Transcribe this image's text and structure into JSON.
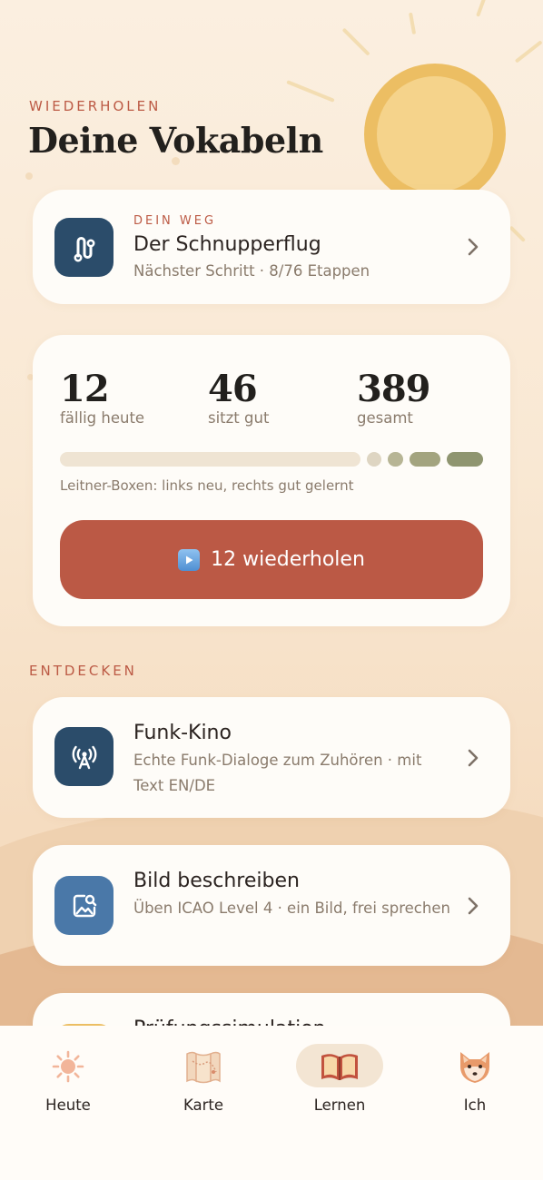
{
  "header": {
    "eyebrow": "WIEDERHOLEN",
    "title": "Deine Vokabeln"
  },
  "path_card": {
    "kicker": "DEIN WEG",
    "title": "Der Schnupperflug",
    "subtitle": "Nächster Schritt · 8/76 Etappen",
    "icon": "route-icon"
  },
  "stats": {
    "due": {
      "value": "12",
      "label": "fällig heute"
    },
    "good": {
      "value": "46",
      "label": "sitzt gut"
    },
    "total": {
      "value": "389",
      "label": "gesamt"
    },
    "leitner_caption": "Leitner-Boxen: links neu, rechts gut gelernt",
    "leitner_boxes": [
      0.77,
      0.01,
      0.04,
      0.08,
      0.12
    ],
    "cta_label": "12 wiederholen"
  },
  "discover": {
    "eyebrow": "ENTDECKEN",
    "items": [
      {
        "title": "Funk-Kino",
        "subtitle": "Echte Funk-Dialoge zum Zuhören · mit Text EN/DE",
        "icon": "radio-antenna-icon"
      },
      {
        "title": "Bild beschreiben",
        "subtitle": "Üben ICAO Level 4 · ein Bild, frei sprechen",
        "icon": "image-search-icon"
      },
      {
        "title": "Prüfungssimulation",
        "subtitle": "",
        "icon": "exam-icon"
      }
    ]
  },
  "tabs": [
    {
      "label": "Heute",
      "icon": "sun-icon"
    },
    {
      "label": "Karte",
      "icon": "map-icon"
    },
    {
      "label": "Lernen",
      "icon": "book-icon"
    },
    {
      "label": "Ich",
      "icon": "fox-icon"
    }
  ],
  "colors": {
    "accent": "#bb5945",
    "navy_tile": "#2b4c6a",
    "blue_tile": "#4a78a8",
    "sun": "#ecbe63"
  }
}
